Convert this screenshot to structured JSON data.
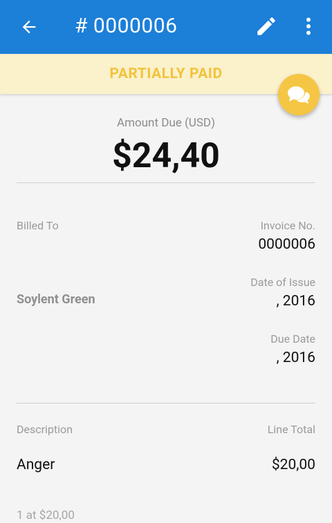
{
  "appbar": {
    "title": "# 0000006",
    "back_icon": "arrow-left-icon",
    "edit_icon": "pencil-icon",
    "more_icon": "more-vertical-icon",
    "color": "#1c7fd8"
  },
  "status": {
    "label": "PARTIALLY PAID",
    "color": "#f2c33c",
    "background": "#fbf1cb"
  },
  "fab": {
    "icon": "chat-bubbles-icon",
    "color": "#f5c643"
  },
  "amount": {
    "label": "Amount Due (USD)",
    "value": "$24,40"
  },
  "billing": {
    "billed_to_label": "Billed To",
    "client_name": "Soylent Green",
    "invoice_no_label": "Invoice No.",
    "invoice_no": "0000006",
    "issue_date_label": "Date of Issue",
    "issue_date": ", 2016",
    "due_date_label": "Due Date",
    "due_date": ", 2016"
  },
  "items": {
    "description_header": "Description",
    "line_total_header": "Line Total",
    "rows": [
      {
        "name": "Anger",
        "total": "$20,00",
        "detail": "1 at $20,00"
      }
    ]
  }
}
